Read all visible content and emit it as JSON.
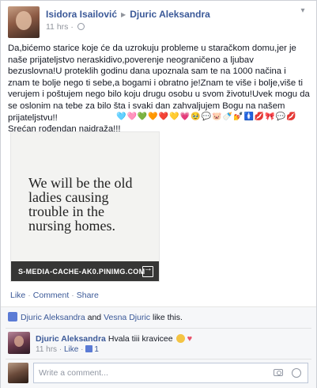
{
  "post": {
    "author": "Isidora Isailović",
    "target": "Djuric Aleksandra",
    "time": "11 hrs",
    "text_lines": [
      "Da,bićemo starice koje će da uzrokuju probleme u staračkom domu,jer je naše prijateljstvo neraskidivo,poverenje neograničeno a ljubav bezuslovna!U proteklih godinu dana upoznala sam te na 1000 načina i znam te bolje nego ti sebe,a bogami i obratno je!Znam te više i bolje,više ti verujem i poštujem nego bilo koju drugu osobu u svom životu!Uvek mogu da se oslonim na tebe za bilo šta i svaki dan zahvaljujem Bogu na našem prijateljstvu!!",
      "Srećan rođendan najdraža!!!"
    ],
    "emojis": [
      "🩵",
      "🩷",
      "💚",
      "🧡",
      "❤️",
      "💛",
      "💗",
      "🥹",
      "💬",
      "🐷",
      "🍼",
      "💅",
      "🚺",
      "💋",
      "🎀",
      "💬",
      "💋"
    ],
    "photo": {
      "quote": "We will be the old ladies causing trouble in the nursing homes.",
      "domain": "S-MEDIA-CACHE-AK0.PINIMG.COM"
    },
    "actions": {
      "like": "Like",
      "comment": "Comment",
      "share": "Share"
    }
  },
  "likes": {
    "names": [
      "Djuric Aleksandra",
      "Vesna Djuric"
    ],
    "connector": "and",
    "suffix": "like this."
  },
  "comment": {
    "author": "Djuric Aleksandra",
    "text": "Hvala tiii kravicee",
    "time": "11 hrs",
    "like_label": "Like",
    "like_count": "1"
  },
  "composer": {
    "placeholder": "Write a comment..."
  }
}
